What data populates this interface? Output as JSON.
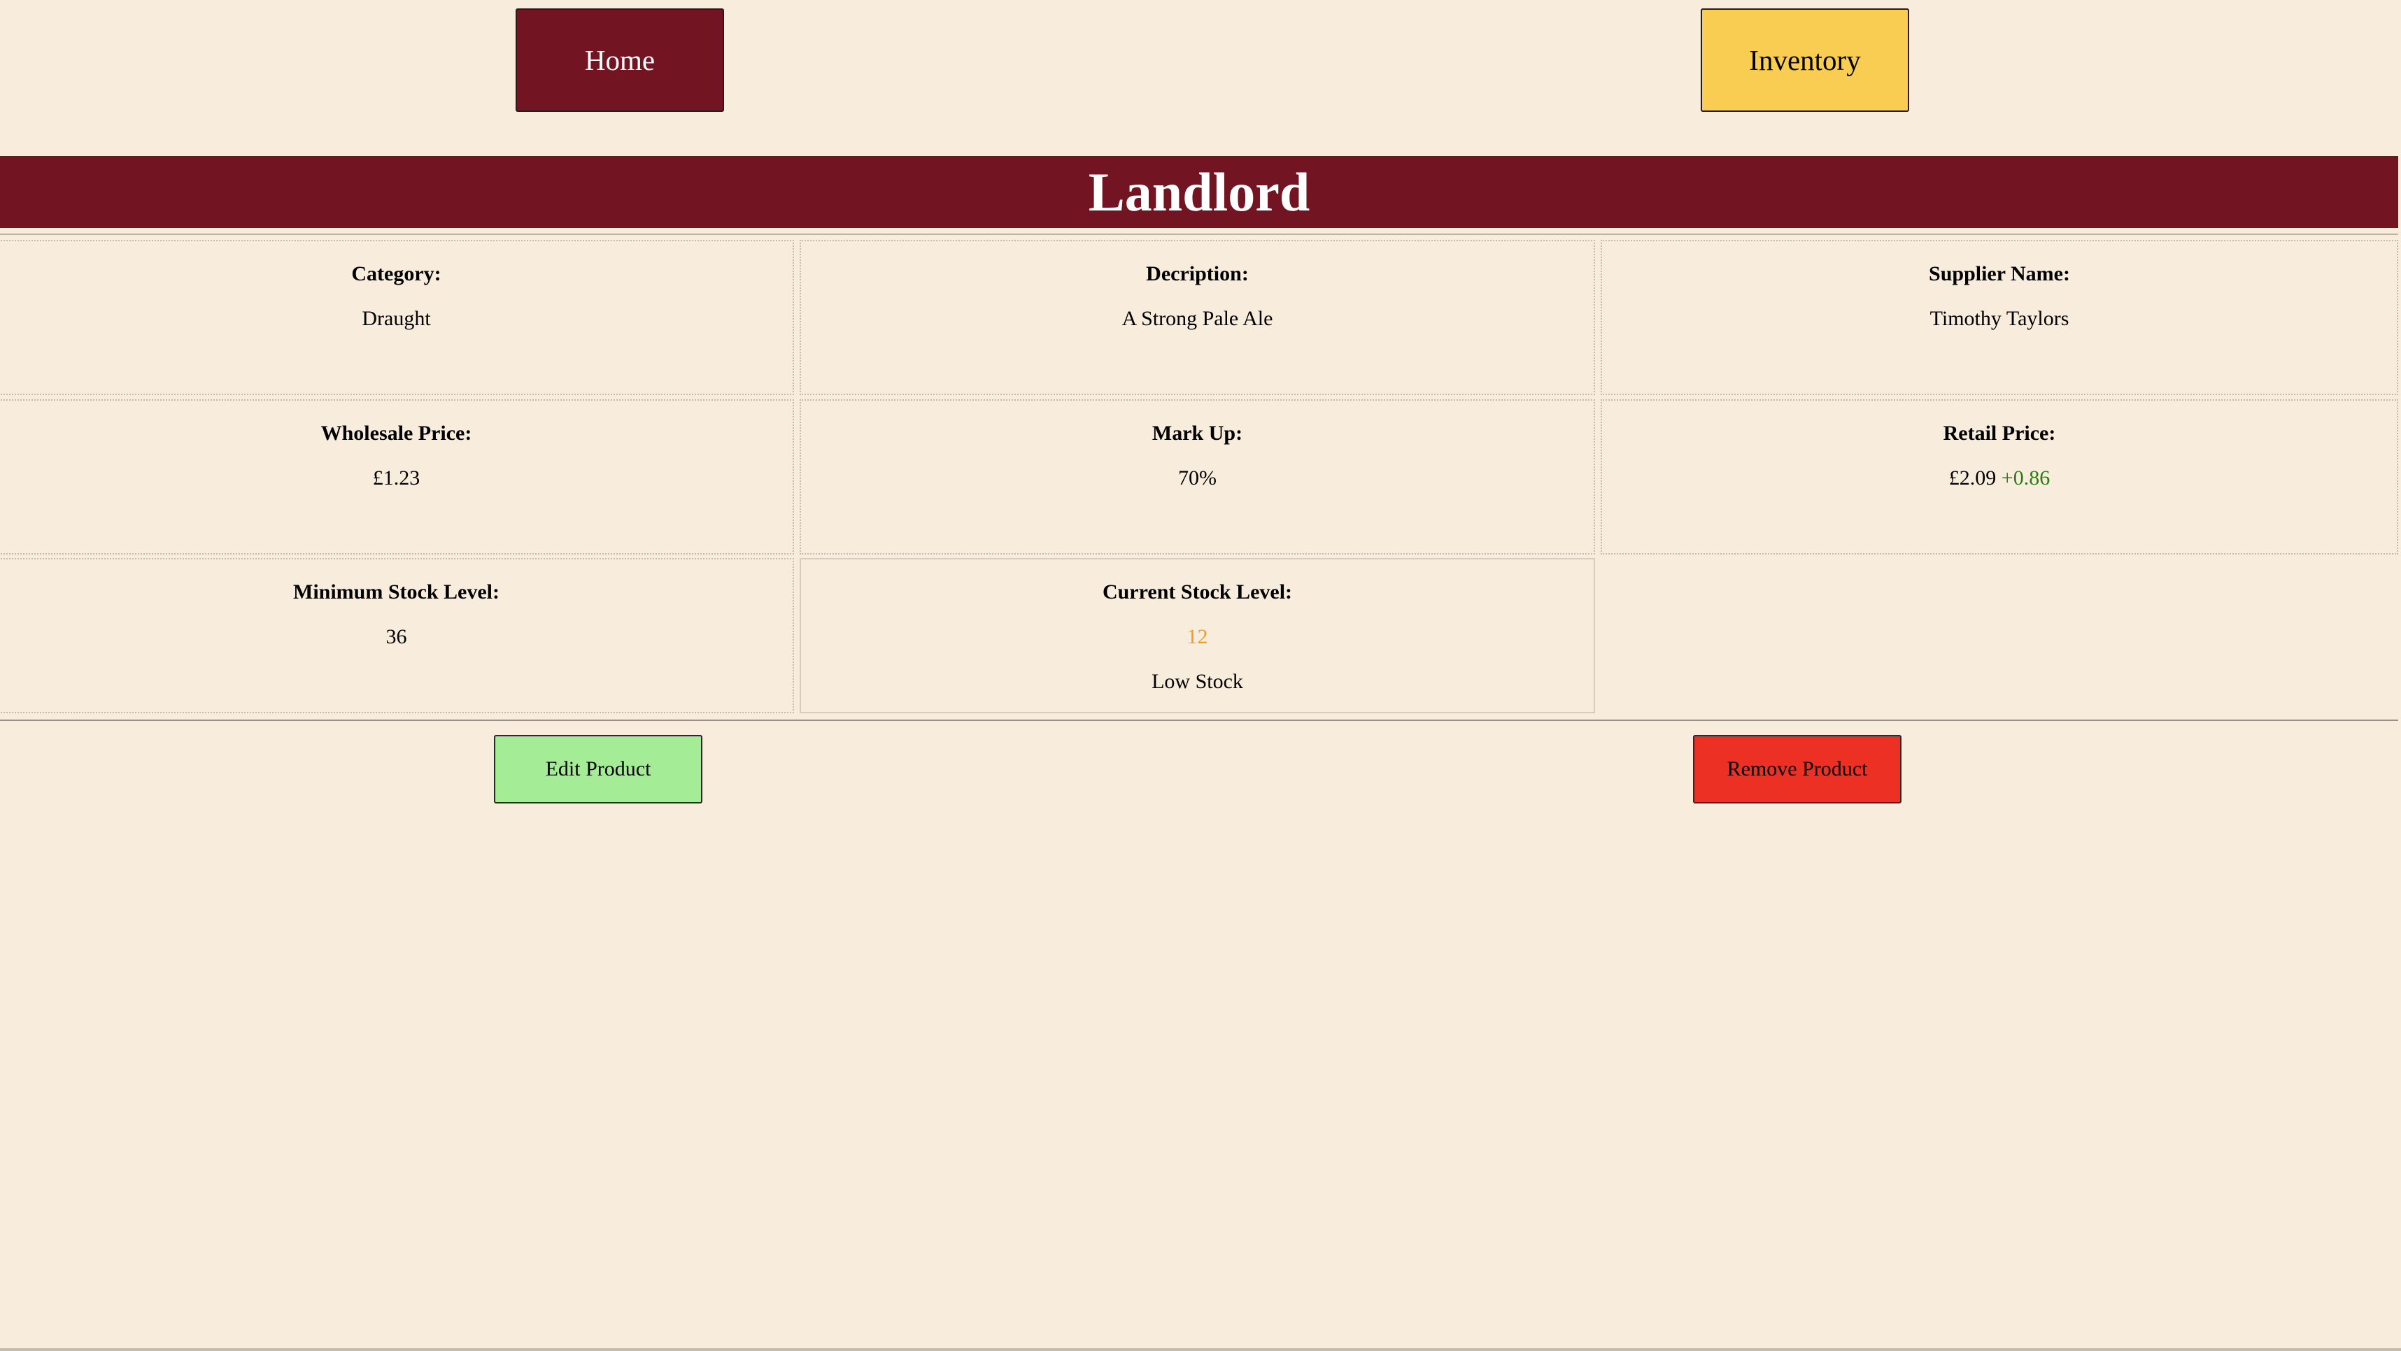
{
  "nav": {
    "home_label": "Home",
    "inventory_label": "Inventory"
  },
  "product": {
    "name": "Landlord"
  },
  "details": {
    "category": {
      "label": "Category:",
      "value": "Draught"
    },
    "description": {
      "label": "Decription:",
      "value": "A Strong Pale Ale"
    },
    "supplier": {
      "label": "Supplier Name:",
      "value": "Timothy Taylors"
    },
    "wholesale": {
      "label": "Wholesale Price:",
      "value": "£1.23"
    },
    "markup": {
      "label": "Mark Up:",
      "value": "70%"
    },
    "retail": {
      "label": "Retail Price:",
      "value": "£2.09",
      "change": "+0.86"
    },
    "min_stock": {
      "label": "Minimum Stock Level:",
      "value": "36"
    },
    "current_stock": {
      "label": "Current Stock Level:",
      "value": "12",
      "status": "Low Stock"
    }
  },
  "actions": {
    "edit_label": "Edit Product",
    "remove_label": "Remove Product"
  },
  "colors": {
    "background": "#f8ecdc",
    "brand": "#731423",
    "inventory_button": "#f9cd52",
    "edit_button": "#a4ec96",
    "remove_button": "#ed3024",
    "price_change": "#2c7a12",
    "low_stock_value": "#f29b21"
  }
}
